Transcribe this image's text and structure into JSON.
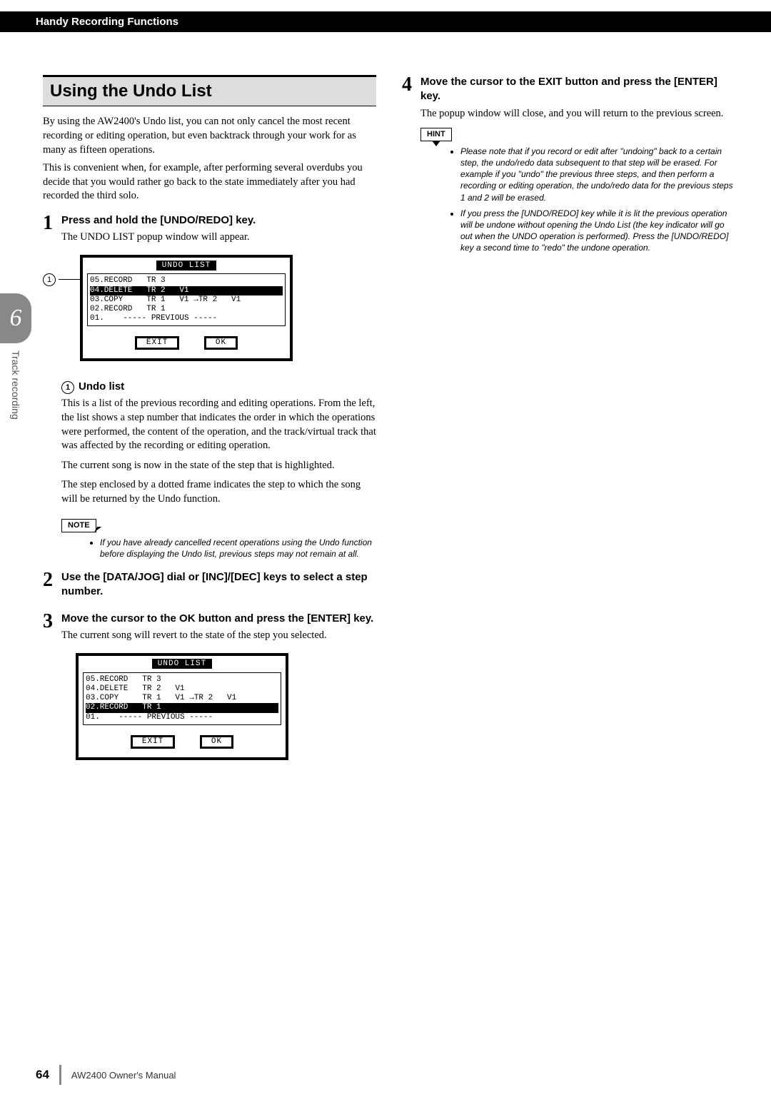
{
  "header": "Handy Recording Functions",
  "sidebar": {
    "chapter": "6",
    "label": "Track recording"
  },
  "left": {
    "title": "Using the Undo List",
    "intro1": "By using the AW2400's Undo list, you can not only cancel the most recent recording or editing operation, but even backtrack through your work for as many as fifteen operations.",
    "intro2": "This is convenient when, for example, after performing several overdubs you decide that you would rather go back to the state immediately after you had recorded the third solo.",
    "step1_title": "Press and hold the [UNDO/REDO] key.",
    "step1_text": "The UNDO LIST popup window will appear.",
    "lcd_title": "UNDO LIST",
    "lcd_rows_a": [
      "05.RECORD   TR 3",
      "04.DELETE   TR 2   V1",
      "03.COPY     TR 1   V1 →TR 2   V1",
      "02.RECORD   TR 1",
      "01.    ----- PREVIOUS -----"
    ],
    "lcd_hl_a": 1,
    "lcd_exit": "EXIT",
    "lcd_ok": "OK",
    "callout_label": "Undo list",
    "callout_p1": "This is a list of the previous recording and editing operations. From the left, the list shows a step number that indicates the order in which the operations were performed, the content of the operation, and the track/virtual track that was affected by the recording or editing operation.",
    "callout_p2": "The current song is now in the state of the step that is highlighted.",
    "callout_p3": "The step enclosed by a dotted frame indicates the step to which the song will be returned by the Undo function.",
    "note_label": "NOTE",
    "note_bullet": "If you have already cancelled recent operations using the Undo function before displaying the Undo list, previous steps may not remain at all.",
    "step2_title": "Use the [DATA/JOG] dial or [INC]/[DEC] keys to select a step number.",
    "step3_title": "Move the cursor to the OK button and press the [ENTER] key.",
    "step3_text": "The current song will revert to the state of the step you selected.",
    "lcd_rows_b": [
      "05.RECORD   TR 3",
      "04.DELETE   TR 2   V1",
      "03.COPY     TR 1   V1 →TR 2   V1",
      "02.RECORD   TR 1",
      "01.    ----- PREVIOUS -----"
    ],
    "lcd_hl_b": 3
  },
  "right": {
    "step4_title": "Move the cursor to the EXIT button and press the [ENTER] key.",
    "step4_text": "The popup window will close, and you will return to the previous screen.",
    "hint_label": "HINT",
    "hint_b1": "Please note that if you record or edit after \"undoing\" back to a certain step, the undo/redo data subsequent to that step will be erased. For example if you \"undo\" the previous three steps, and then perform a recording or editing operation, the undo/redo data for the previous steps 1 and 2 will be erased.",
    "hint_b2": "If you press the [UNDO/REDO] key while it is lit the previous operation will be undone without opening the Undo List (the key indicator will go out when the UNDO operation is performed). Press the [UNDO/REDO] key a second time to \"redo\" the undone operation."
  },
  "footer": {
    "page": "64",
    "manual": "AW2400  Owner's Manual"
  }
}
